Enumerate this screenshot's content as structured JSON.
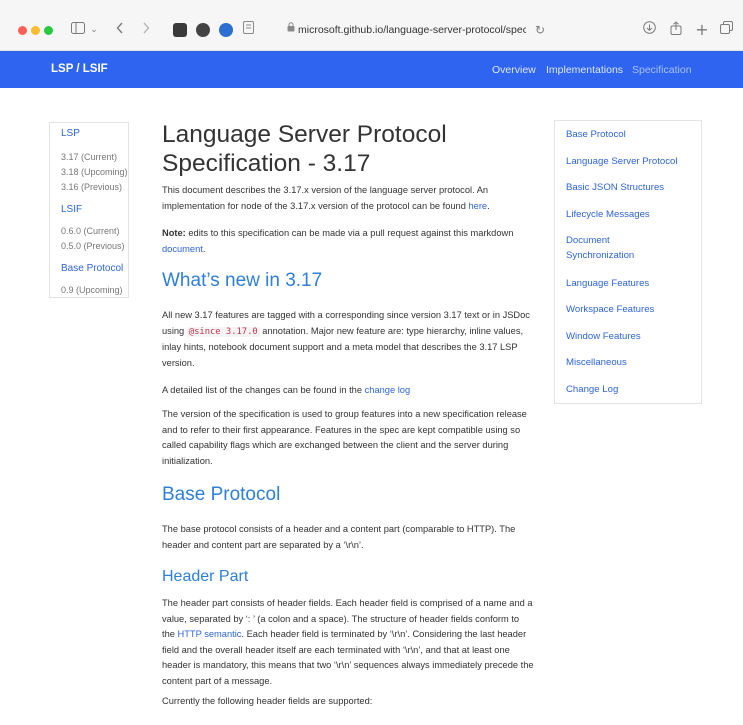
{
  "browser": {
    "url": "microsoft.github.io/language-server-protocol/specific"
  },
  "nav": {
    "brand": "LSP / LSIF",
    "links": [
      "Overview",
      "Implementations",
      "Specification"
    ]
  },
  "left_toc": {
    "lsp_title": "LSP",
    "lsp_items": [
      "3.17 (Current)",
      "3.18 (Upcoming)",
      "3.16 (Previous)"
    ],
    "lsif_title": "LSIF",
    "lsif_items": [
      "0.6.0 (Current)",
      "0.5.0 (Previous)"
    ],
    "base_title": "Base Protocol",
    "base_items": [
      "0.9 (Upcoming)"
    ]
  },
  "right_toc": {
    "items": [
      "Base Protocol",
      "Language Server Protocol",
      "Basic JSON Structures",
      "Lifecycle Messages",
      "Document Synchronization",
      "Language Features",
      "Workspace Features",
      "Window Features",
      "Miscellaneous",
      "Change Log"
    ]
  },
  "content": {
    "title": "Language Server Protocol Specification - 3.17",
    "intro_1": "This document describes the 3.17.x version of the language server protocol. An implementation for node of the 3.17.x version of the protocol can be found",
    "intro_link": "here",
    "note_label": "Note:",
    "note_text": "edits to this specification can be made via a pull request against this markdown",
    "note_link": "document",
    "whats_new": "What’s new in 3.17",
    "new_1a": "All new 3.17 features are tagged with a corresponding since version 3.17 text or in JSDoc using",
    "new_code": "@since 3.17.0",
    "new_1b": "annotation. Major new feature are: type hierarchy, inline values, inlay hints, notebook document support and a meta model that describes the 3.17 LSP version.",
    "changes_text": "A detailed list of the changes can be found in the",
    "changes_link": "change log",
    "version_text": "The version of the specification is used to group features into a new specification release and to refer to their first appearance. Features in the spec are kept compatible using so called capability flags which are exchanged between the client and the server during initialization.",
    "base_protocol": "Base Protocol",
    "base_text": "The base protocol consists of a header and a content part (comparable to HTTP). The header and content part are separated by a ‘\\r\\n’.",
    "header_part": "Header Part",
    "header_text_a": "The header part consists of header fields. Each header field is comprised of a name and a value, separated by ‘: ’ (a colon and a space). The structure of header fields conform to the",
    "header_link": "HTTP semantic",
    "header_text_b": ". Each header field is terminated by ‘\\r\\n’. Considering the last header field and the overall header itself are each terminated with ‘\\r\\n’, and that at least one header is mandatory, this means that two ‘\\r\\n’ sequences always immediately precede the content part of a message.",
    "currently_text": "Currently the following header fields are supported:"
  },
  "colors": {
    "nav_bg": "#2e64f0",
    "link": "#2e64d8",
    "heading": "#2e7fd8"
  }
}
